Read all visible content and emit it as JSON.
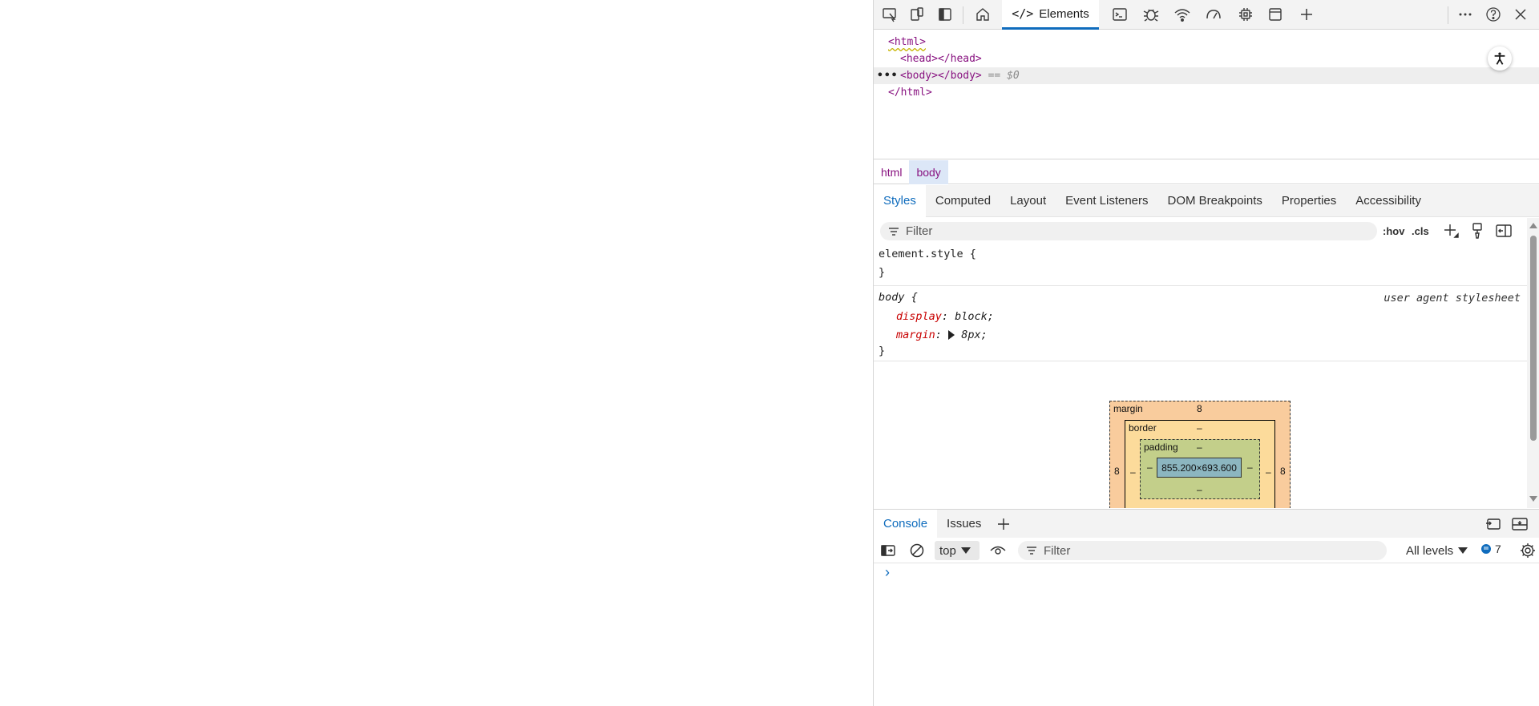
{
  "toolbar": {
    "active_tab_label": "Elements",
    "icons": [
      "inspect-icon",
      "device-emulation-icon",
      "dock-sidebar-icon",
      "home-icon",
      "console-panel-icon",
      "bug-icon",
      "network-wifi-icon",
      "performance-gauge-icon",
      "memory-chip-icon",
      "application-panel-icon",
      "plus-icon",
      "more-icon",
      "help-icon",
      "close-icon"
    ]
  },
  "dom": {
    "lines": [
      {
        "open": "<html>",
        "close": ""
      },
      {
        "open": "<head>",
        "close": "</head>"
      },
      {
        "open": "<body>",
        "close": "</body>",
        "suffix": " == $0"
      },
      {
        "open": "</html>",
        "close": ""
      }
    ],
    "dots": "•••"
  },
  "breadcrumb": {
    "items": [
      "html",
      "body"
    ]
  },
  "subtabs": [
    "Styles",
    "Computed",
    "Layout",
    "Event Listeners",
    "DOM Breakpoints",
    "Properties",
    "Accessibility"
  ],
  "styles": {
    "filter_placeholder": "Filter",
    "hov": ":hov",
    "cls": ".cls",
    "element_style": {
      "selector": "element.style {",
      "close": "}"
    },
    "body_rule": {
      "selector": "body {",
      "source": "user agent stylesheet",
      "props": [
        {
          "name": "display",
          "value": "block;"
        },
        {
          "name": "margin",
          "value": "8px;"
        }
      ],
      "close": "}"
    }
  },
  "box_model": {
    "margin_label": "margin",
    "margin_top": "8",
    "margin_left": "8",
    "margin_right": "8",
    "border_label": "border",
    "border_top": "–",
    "border_left": "–",
    "border_right": "–",
    "padding_label": "padding",
    "padding_top": "–",
    "padding_left": "–",
    "padding_right": "–",
    "padding_bottom": "–",
    "content": "855.200×693.600"
  },
  "drawer": {
    "tabs": [
      "Console",
      "Issues"
    ],
    "context": "top",
    "filter_placeholder": "Filter",
    "levels": "All levels",
    "issues_count": "7",
    "prompt": "›"
  },
  "colors": {
    "accent": "#0f6cbd",
    "tag": "#881280",
    "prop_name": "#c80000"
  }
}
